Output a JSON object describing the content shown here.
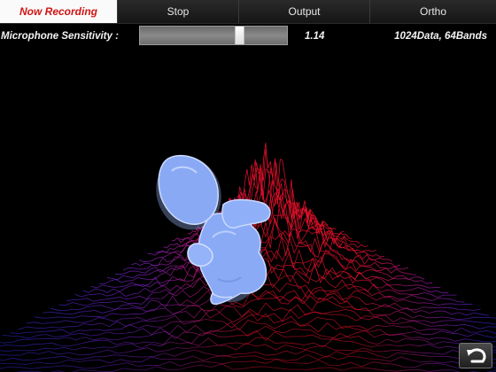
{
  "tabs": [
    {
      "label": "Now Recording",
      "active": true
    },
    {
      "label": "Stop",
      "active": false
    },
    {
      "label": "Output",
      "active": false
    },
    {
      "label": "Ortho",
      "active": false
    }
  ],
  "sensitivity": {
    "label": "Microphone Sensitivity :",
    "value": "1.14",
    "slider_fraction": 0.69
  },
  "data_info": "1024Data, 64Bands",
  "icons": {
    "reset": "undo-arrow-icon",
    "character": "blob-figure-icon"
  },
  "colors": {
    "accent": "#d11414",
    "wave_red": "#e0102a",
    "wave_blue": "#2a2ad8",
    "figure": "#8fb2ff"
  }
}
